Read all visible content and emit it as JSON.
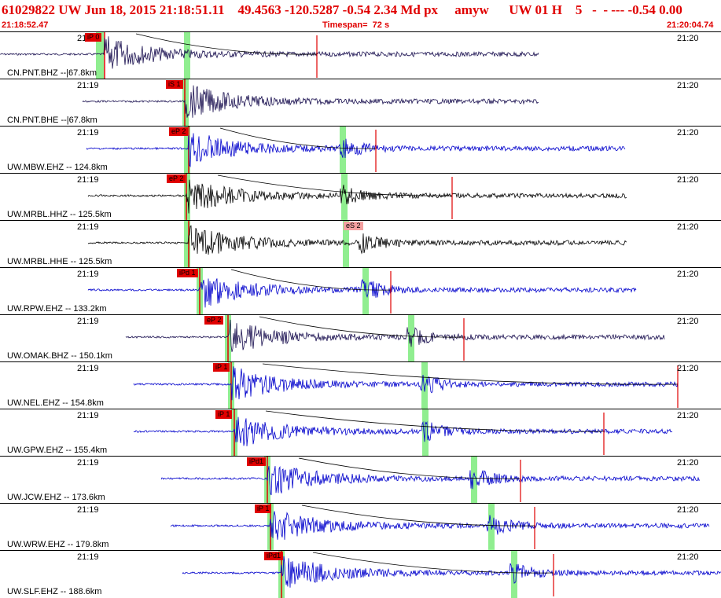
{
  "header": {
    "title": "61029822 UW Jun 18, 2015 21:18:51.11    49.4563 -120.5287 -0.54 2.34 Md px     amyw      UW 01 H    5   -  - --- -0.54 0.00",
    "start_time": "21:18:52.47",
    "timespan": "Timespan=  72 s",
    "end_time": "21:20:04.74"
  },
  "colors": {
    "header_text": "#e00000",
    "pick_box": "#e00000",
    "pick_box_s": "#f4a0a0",
    "trace_blue": "#0000cc",
    "trace_navy": "#1a1050",
    "trace_black": "#000000",
    "window_band": "#90ee90"
  },
  "panels": [
    {
      "label": "CN.PNT.BHZ --|67.8km",
      "time_left": "21:19",
      "time_right": "21:20",
      "pick": "iP 0",
      "pick_type": "p",
      "color": "navy"
    },
    {
      "label": "CN.PNT.BHE --|67.8km",
      "time_left": "21:19",
      "time_right": "21:20",
      "pick": "iS 1",
      "pick_type": "p",
      "color": "navy"
    },
    {
      "label": "UW.MBW.EHZ -- 124.8km",
      "time_left": "21:19",
      "time_right": "21:20",
      "pick": "eP 2",
      "pick_type": "p",
      "color": "blue"
    },
    {
      "label": "UW.MRBL.HHZ -- 125.5km",
      "time_left": "21:19",
      "time_right": "21:20",
      "pick": "eP 2",
      "pick_type": "p",
      "color": "black"
    },
    {
      "label": "UW.MRBL.HHE -- 125.5km",
      "time_left": "21:19",
      "time_right": "21:20",
      "pick": "eS 2",
      "pick_type": "s",
      "color": "black"
    },
    {
      "label": "UW.RPW.EHZ -- 133.2km",
      "time_left": "21:19",
      "time_right": "21:20",
      "pick": "iPd 1",
      "pick_type": "p",
      "color": "blue"
    },
    {
      "label": "UW.OMAK.BHZ -- 150.1km",
      "time_left": "21:19",
      "time_right": "21:20",
      "pick": "eP 2",
      "pick_type": "p",
      "color": "navy"
    },
    {
      "label": "UW.NEL.EHZ -- 154.8km",
      "time_left": "21:19",
      "time_right": "21:20",
      "pick": "iP 1",
      "pick_type": "p",
      "color": "blue"
    },
    {
      "label": "UW.GPW.EHZ -- 155.4km",
      "time_left": "21:19",
      "time_right": "21:20",
      "pick": "iP 1",
      "pick_type": "p",
      "color": "blue"
    },
    {
      "label": "UW.JCW.EHZ -- 173.6km",
      "time_left": "21:19",
      "time_right": "21:20",
      "pick": "iPd1",
      "pick_type": "p",
      "color": "blue"
    },
    {
      "label": "UW.WRW.EHZ -- 179.8km",
      "time_left": "21:19",
      "time_right": "21:20",
      "pick": "iP 1",
      "pick_type": "p",
      "color": "blue"
    },
    {
      "label": "UW.SLF.EHZ -- 188.6km",
      "time_left": "21:19",
      "time_right": "21:20",
      "pick": "iPd1",
      "pick_type": "p",
      "color": "blue"
    }
  ]
}
